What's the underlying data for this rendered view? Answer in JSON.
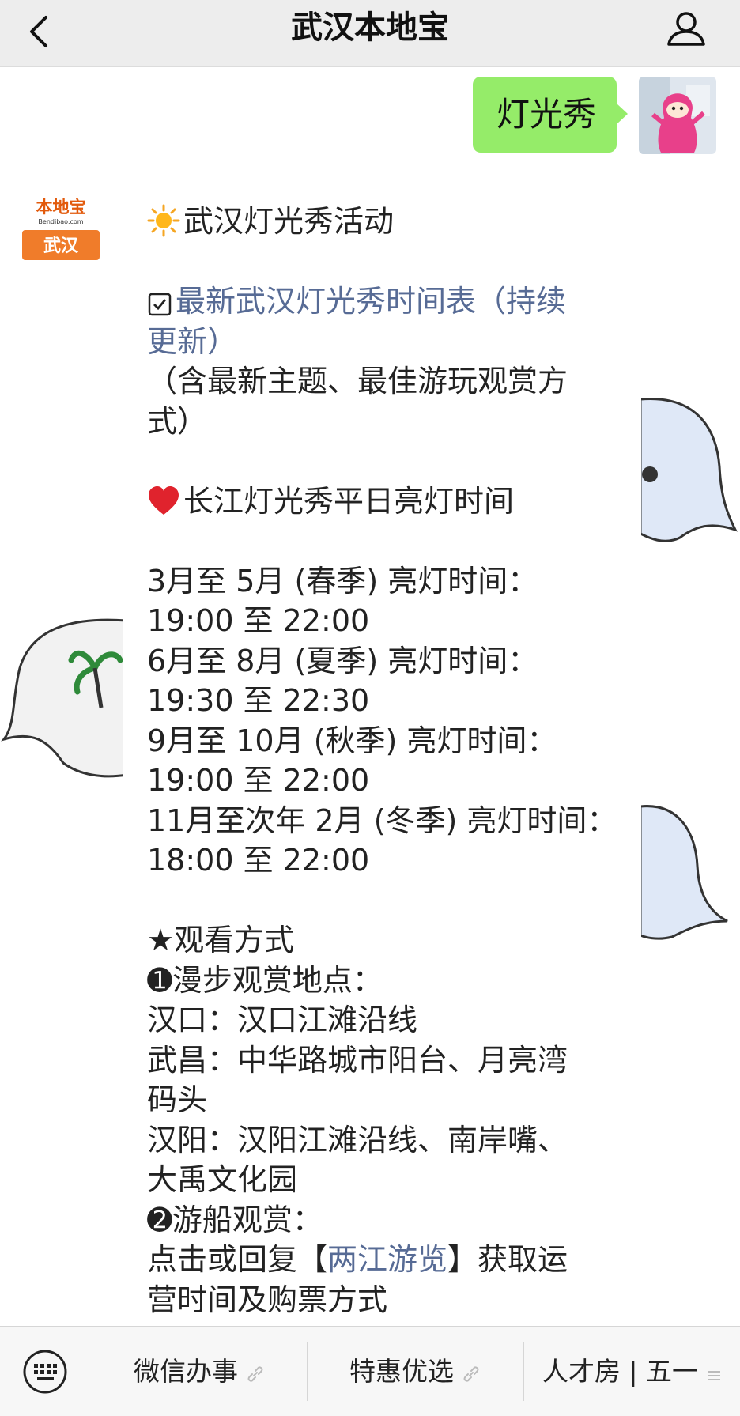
{
  "header": {
    "title": "武汉本地宝"
  },
  "chat": {
    "sent_message": "灯光秀",
    "bot_avatar": {
      "top_text": "本地宝",
      "domain_text": "Bendibao.com",
      "city_text": "武汉"
    },
    "reply": {
      "title": "武汉灯光秀活动",
      "link1_line1": "最新武汉灯光秀时间表（持续",
      "link1_line2": "更新）",
      "note_line1": "（含最新主题、最佳游玩观赏方",
      "note_line2": "式）",
      "section1": "长江灯光秀平日亮灯时间",
      "spring_label": "3月至 5月 (春季) 亮灯时间：",
      "spring_time": "19:00 至 22:00",
      "summer_label": "6月至 8月 (夏季) 亮灯时间：",
      "summer_time": "19:30 至 22:30",
      "autumn_label": "9月至 10月 (秋季) 亮灯时间：",
      "autumn_time": "19:00 至 22:00",
      "winter_label": "11月至次年 2月 (冬季) 亮灯时间：",
      "winter_time": "18:00 至 22:00",
      "view_title": "★观看方式",
      "walk_title": "➊漫步观赏地点：",
      "hankou": "汉口：汉口江滩沿线",
      "wuchang_line1": "武昌：中华路城市阳台、月亮湾",
      "wuchang_line2": "码头",
      "hanyang_line1": "汉阳：汉阳江滩沿线、南岸嘴、",
      "hanyang_line2": "大禹文化园",
      "boat_title": "➋游船观赏：",
      "boat_prefix": "点击或回复【",
      "boat_link": "两江游览",
      "boat_suffix": "】获取运",
      "boat_line2": "营时间及购票方式"
    }
  },
  "menu": {
    "items": [
      "微信办事",
      "特惠优选",
      "人才房 | 五一"
    ]
  },
  "colors": {
    "header_bg": "#ededed",
    "sent_bubble": "#95ec69",
    "link": "#576b95",
    "brand_orange": "#f07c2a"
  },
  "icons": [
    "back-icon",
    "profile-icon",
    "sun-icon",
    "checkbox-icon",
    "heart-icon",
    "keyboard-icon",
    "link-icon",
    "menu-lines-icon"
  ]
}
